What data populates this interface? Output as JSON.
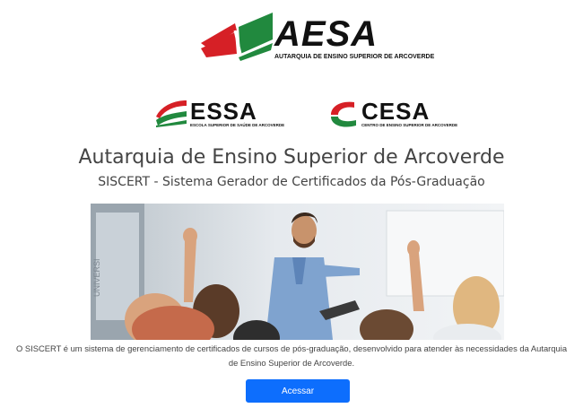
{
  "logos": {
    "aesa": {
      "name": "AESA",
      "tagline": "AUTARQUIA DE ENSINO SUPERIOR DE ARCOVERDE",
      "colors": {
        "red": "#d62026",
        "green": "#21893e"
      }
    },
    "essa": {
      "name": "ESSA",
      "tagline": "ESCOLA SUPERIOR DE SAÚDE DE ARCOVERDE"
    },
    "cesa": {
      "name": "CESA",
      "tagline": "CENTRO DE ENSINO SUPERIOR DE ARCOVERDE"
    }
  },
  "header": {
    "title": "Autarquia de Ensino Superior de Arcoverde",
    "subtitle": "SISCERT - Sistema Gerador de Certificados da Pós-Graduação"
  },
  "hero": {
    "overlay_text": "UNIVERSI"
  },
  "main": {
    "description": "O SISCERT é um sistema de gerenciamento de certificados de cursos de pós-graduação, desenvolvido para atender às necessidades da Autarquia de Ensino Superior de Arcoverde.",
    "access_button": "Acessar"
  },
  "colors": {
    "button": "#0d6efd",
    "text": "#444444"
  }
}
